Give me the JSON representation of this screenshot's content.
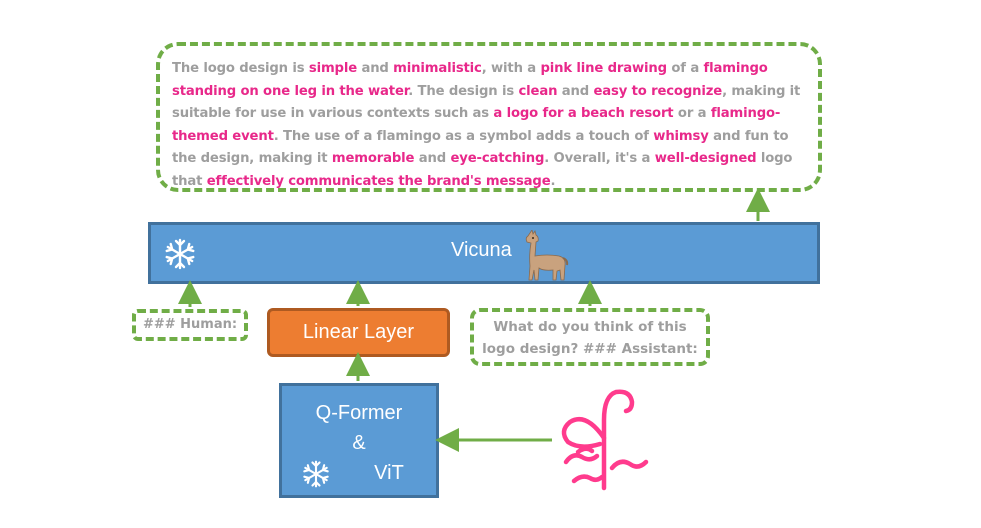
{
  "output": {
    "segments": [
      {
        "text": "The logo design is ",
        "hl": false
      },
      {
        "text": "simple",
        "hl": true
      },
      {
        "text": " and ",
        "hl": false
      },
      {
        "text": "minimalistic",
        "hl": true
      },
      {
        "text": ", with a ",
        "hl": false
      },
      {
        "text": "pink line drawing",
        "hl": true
      },
      {
        "text": " of a ",
        "hl": false
      },
      {
        "text": "flamingo standing on one leg in the water",
        "hl": true
      },
      {
        "text": ". The design is ",
        "hl": false
      },
      {
        "text": "clean",
        "hl": true
      },
      {
        "text": " and ",
        "hl": false
      },
      {
        "text": "easy to recognize",
        "hl": true
      },
      {
        "text": ", making it suitable for use in various contexts such as ",
        "hl": false
      },
      {
        "text": "a logo for a beach resort",
        "hl": true
      },
      {
        "text": " or a ",
        "hl": false
      },
      {
        "text": "flamingo-themed event",
        "hl": true
      },
      {
        "text": ". The use of a flamingo as a symbol adds a touch of ",
        "hl": false
      },
      {
        "text": "whimsy",
        "hl": true
      },
      {
        "text": " and fun to the design, making it ",
        "hl": false
      },
      {
        "text": "memorable",
        "hl": true
      },
      {
        "text": " and ",
        "hl": false
      },
      {
        "text": "eye-catching",
        "hl": true
      },
      {
        "text": ". Overall, it's a ",
        "hl": false
      },
      {
        "text": "well-designed",
        "hl": true
      },
      {
        "text": " logo that ",
        "hl": false
      },
      {
        "text": "effectively communicates the brand's message",
        "hl": true
      },
      {
        "text": ".",
        "hl": false
      }
    ]
  },
  "vicuna": {
    "label": "Vicuna"
  },
  "human_prompt": "### Human:",
  "assistant_prompt": {
    "line1": "What do you think of this",
    "line2": "logo design? ### Assistant:"
  },
  "linear_layer": {
    "label": "Linear Layer"
  },
  "qformer": {
    "line1": "Q-Former",
    "line2": "&",
    "line3": "ViT"
  },
  "icons": {
    "frozen": "snowflake-icon",
    "llama": "llama-icon",
    "input_image": "flamingo-logo"
  },
  "colors": {
    "arrow": "#70ad47",
    "blue_fill": "#5b9bd5",
    "blue_border": "#41719c",
    "orange_fill": "#ed7d31",
    "highlight": "#e8288a",
    "gray_text": "#9e9e9e",
    "flamingo": "#ff3b8d"
  }
}
